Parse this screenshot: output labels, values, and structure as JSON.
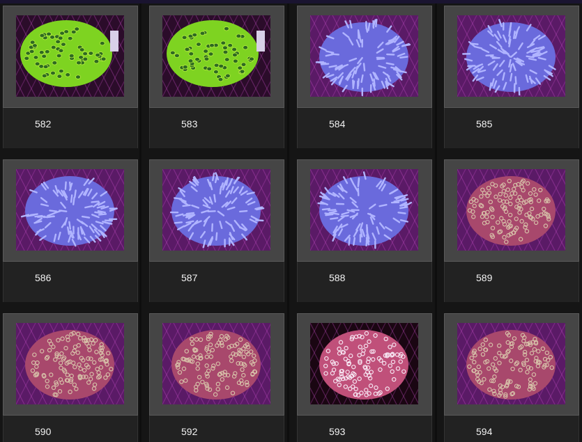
{
  "grid": {
    "items": [
      {
        "label": "582",
        "coral": "green-brain"
      },
      {
        "label": "583",
        "coral": "green-brain"
      },
      {
        "label": "584",
        "coral": "blue-polyp"
      },
      {
        "label": "585",
        "coral": "blue-polyp"
      },
      {
        "label": "586",
        "coral": "blue-polyp"
      },
      {
        "label": "587",
        "coral": "blue-polyp"
      },
      {
        "label": "588",
        "coral": "blue-polyp"
      },
      {
        "label": "589",
        "coral": "pink-polyp"
      },
      {
        "label": "590",
        "coral": "pink-polyp"
      },
      {
        "label": "592",
        "coral": "pink-polyp"
      },
      {
        "label": "593",
        "coral": "pink-white-polyp"
      },
      {
        "label": "594",
        "coral": "pink-polyp"
      }
    ]
  },
  "colors": {
    "page_bg": "#151515",
    "frame_bg": "#454545",
    "label_bg": "#222222",
    "label_text": "#f2f2f2"
  }
}
